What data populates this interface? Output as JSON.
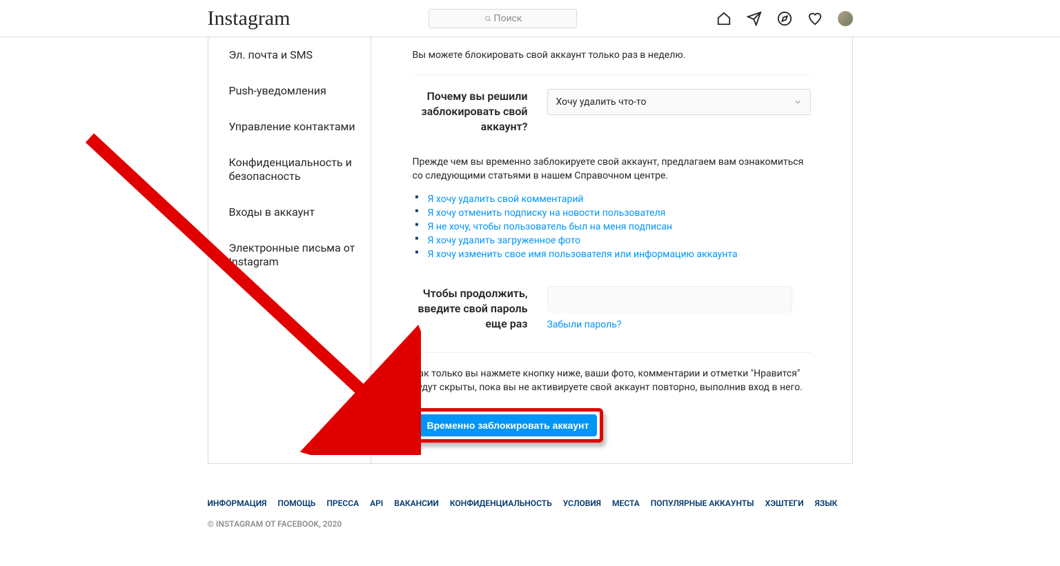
{
  "header": {
    "logo": "Instagram",
    "search_placeholder": "Поиск"
  },
  "sidebar": {
    "items": [
      "Эл. почта и SMS",
      "Push-уведомления",
      "Управление контактами",
      "Конфиденциальность и безопасность",
      "Входы в аккаунт",
      "Электронные письма от Instagram"
    ]
  },
  "main": {
    "top_info": "Вы можете блокировать свой аккаунт только раз в неделю.",
    "reason_label": "Почему вы решили заблокировать свой аккаунт?",
    "reason_selected": "Хочу удалить что-то",
    "help_intro": "Прежде чем вы временно заблокируете свой аккаунт, предлагаем вам ознакомиться со следующими статьями в нашем Справочном центре.",
    "help_links": [
      "Я хочу удалить свой комментарий",
      "Я хочу отменить подписку на новости пользователя",
      "Я не хочу, чтобы пользователь был на меня подписан",
      "Я хочу удалить загруженное фото",
      "Я хочу изменить свое имя пользователя или информацию аккаунта"
    ],
    "password_label": "Чтобы продолжить, введите свой пароль еще раз",
    "forgot_password": "Забыли пароль?",
    "final_text": "Как только вы нажмете кнопку ниже, ваши фото, комментарии и отметки \"Нравится\" будут скрыты, пока вы не активируете свой аккаунт повторно, выполнив вход в него.",
    "submit_label": "Временно заблокировать аккаунт"
  },
  "footer": {
    "links": [
      "ИНФОРМАЦИЯ",
      "ПОМОЩЬ",
      "ПРЕССА",
      "API",
      "ВАКАНСИИ",
      "КОНФИДЕНЦИАЛЬНОСТЬ",
      "УСЛОВИЯ",
      "МЕСТА",
      "ПОПУЛЯРНЫЕ АККАУНТЫ",
      "ХЭШТЕГИ",
      "ЯЗЫК"
    ],
    "copyright": "© INSTAGRAM ОТ FACEBOOK, 2020"
  }
}
